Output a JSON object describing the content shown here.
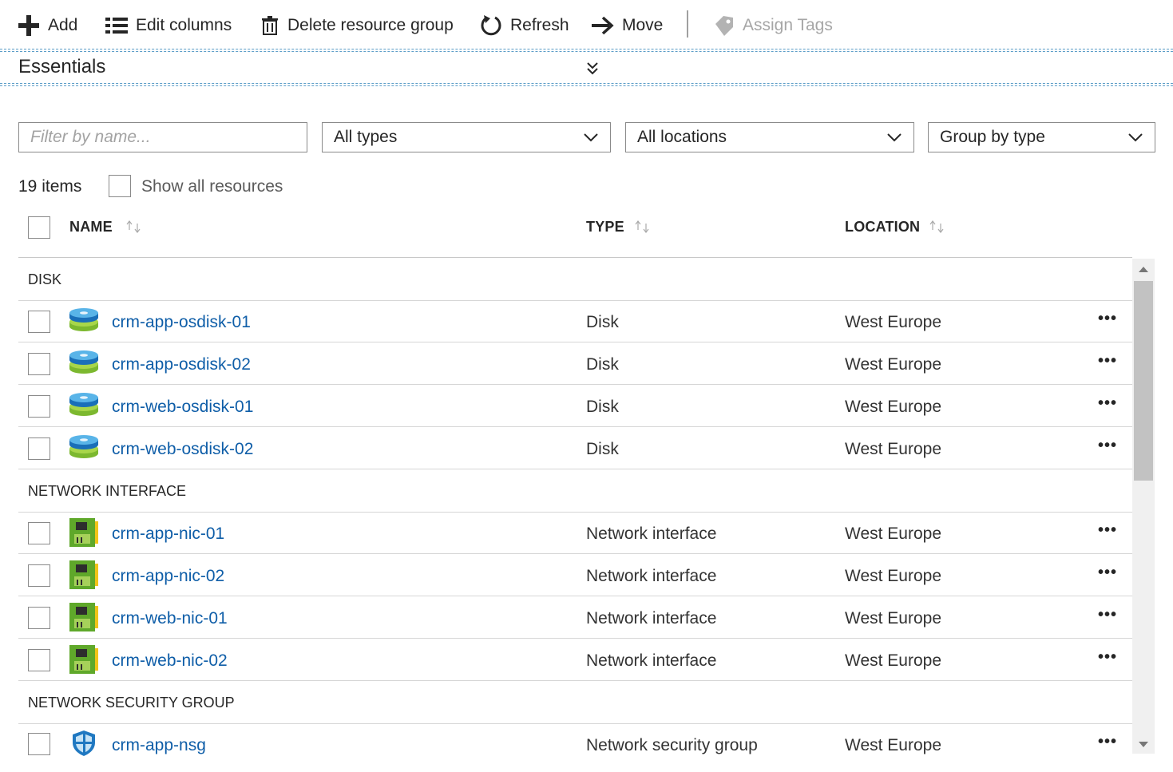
{
  "toolbar": {
    "add": "Add",
    "edit_columns": "Edit columns",
    "delete_group": "Delete resource group",
    "refresh": "Refresh",
    "move": "Move",
    "assign_tags": "Assign Tags"
  },
  "essentials": {
    "title": "Essentials"
  },
  "filters": {
    "name_placeholder": "Filter by name...",
    "types": "All types",
    "locations": "All locations",
    "group_by": "Group by type"
  },
  "summary": {
    "count": "19 items",
    "show_all": "Show all resources"
  },
  "columns": {
    "name": "NAME",
    "type": "TYPE",
    "location": "LOCATION"
  },
  "groups": [
    {
      "title": "DISK",
      "items": [
        {
          "name": "crm-app-osdisk-01",
          "type": "Disk",
          "location": "West Europe",
          "icon": "disk-icon"
        },
        {
          "name": "crm-app-osdisk-02",
          "type": "Disk",
          "location": "West Europe",
          "icon": "disk-icon"
        },
        {
          "name": "crm-web-osdisk-01",
          "type": "Disk",
          "location": "West Europe",
          "icon": "disk-icon"
        },
        {
          "name": "crm-web-osdisk-02",
          "type": "Disk",
          "location": "West Europe",
          "icon": "disk-icon"
        }
      ]
    },
    {
      "title": "NETWORK INTERFACE",
      "items": [
        {
          "name": "crm-app-nic-01",
          "type": "Network interface",
          "location": "West Europe",
          "icon": "network-interface-icon"
        },
        {
          "name": "crm-app-nic-02",
          "type": "Network interface",
          "location": "West Europe",
          "icon": "network-interface-icon"
        },
        {
          "name": "crm-web-nic-01",
          "type": "Network interface",
          "location": "West Europe",
          "icon": "network-interface-icon"
        },
        {
          "name": "crm-web-nic-02",
          "type": "Network interface",
          "location": "West Europe",
          "icon": "network-interface-icon"
        }
      ]
    },
    {
      "title": "NETWORK SECURITY GROUP",
      "items": [
        {
          "name": "crm-app-nsg",
          "type": "Network security group",
          "location": "West Europe",
          "icon": "shield-icon"
        }
      ]
    }
  ],
  "more_label": "•••",
  "colors": {
    "link": "#0f5ea8",
    "accent_line": "#5d9ec8"
  }
}
